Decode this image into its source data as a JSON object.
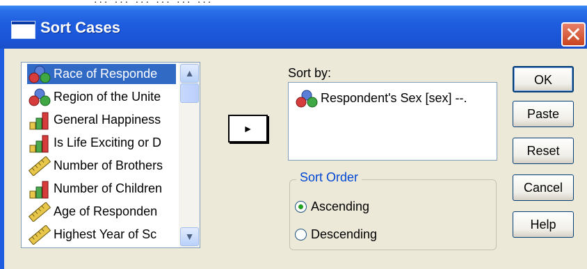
{
  "window": {
    "title": "Sort Cases",
    "close_glyph": "✕",
    "background_text": "... ... ... ... ... ..."
  },
  "variables_list": {
    "items": [
      {
        "label": "Race of Responde",
        "icon": "nominal-variable-icon",
        "selected": true
      },
      {
        "label": "Region of the Unite",
        "icon": "nominal-variable-icon",
        "selected": false
      },
      {
        "label": "General Happiness",
        "icon": "ordinal-variable-icon",
        "selected": false
      },
      {
        "label": "Is Life Exciting or D",
        "icon": "ordinal-variable-icon",
        "selected": false
      },
      {
        "label": "Number of Brothers",
        "icon": "scale-variable-icon",
        "selected": false
      },
      {
        "label": "Number of Children",
        "icon": "ordinal-variable-icon",
        "selected": false
      },
      {
        "label": "Age of Responden",
        "icon": "scale-variable-icon",
        "selected": false
      },
      {
        "label": "Highest Year of Sc",
        "icon": "scale-variable-icon",
        "selected": false
      }
    ],
    "scroll_up_glyph": "▲",
    "scroll_down_glyph": "▼"
  },
  "move_button": {
    "glyph": "►"
  },
  "sort_by": {
    "label": "Sort by:",
    "items": [
      {
        "label": "Respondent's Sex [sex] --.",
        "icon": "nominal-variable-icon"
      }
    ]
  },
  "sort_order": {
    "legend": "Sort Order",
    "options": [
      {
        "label": "Ascending",
        "checked": true
      },
      {
        "label": "Descending",
        "checked": false
      }
    ]
  },
  "buttons": {
    "ok": "OK",
    "paste": "Paste",
    "reset": "Reset",
    "cancel": "Cancel",
    "help": "Help"
  },
  "colors": {
    "titlebar": "#1f5ee0",
    "selection": "#316ac5",
    "dialog_bg": "#ece9d8",
    "group_legend": "#0046d5"
  }
}
